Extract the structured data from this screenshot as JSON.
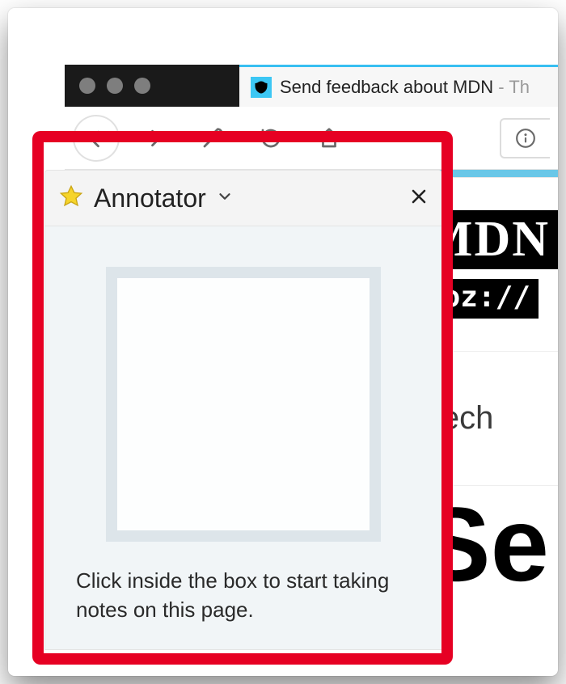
{
  "tab": {
    "title": "Send feedback about MDN",
    "suffix": " - Th"
  },
  "sidebar": {
    "title": "Annotator",
    "hint": "Click inside the box to start taking notes on this page."
  },
  "page": {
    "logo_line1": "MDN",
    "logo_line2": "moz://",
    "nav_item": "Tech",
    "heading_initial": "Se"
  }
}
